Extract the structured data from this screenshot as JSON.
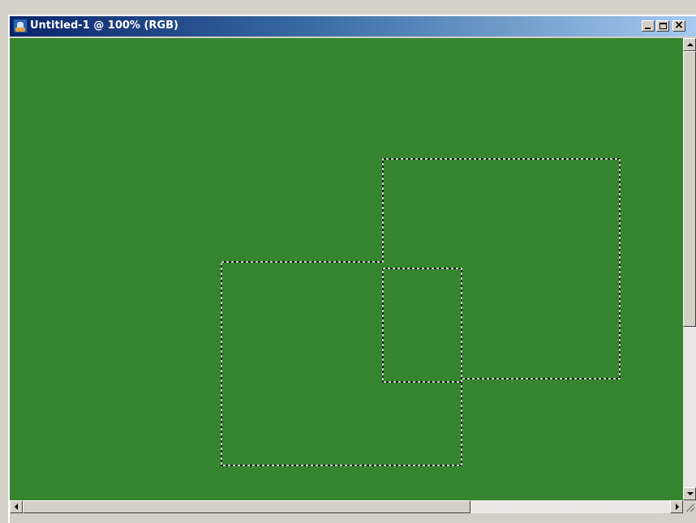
{
  "window": {
    "title": "Untitled-1 @ 100% (RGB)",
    "icon": "photoshop-document-icon",
    "controls": {
      "minimize": "minimize-icon",
      "maximize": "maximize-icon",
      "close": "close-icon",
      "close_glyph": "×"
    }
  },
  "canvas": {
    "fill_color": "#35852f",
    "selection_style": "marching-ants-dashed",
    "selection_count": 2
  },
  "scrollbars": {
    "vertical": {
      "position": 0.0,
      "visible_fraction": 0.6
    },
    "horizontal": {
      "position": 0.0,
      "visible_fraction": 0.7
    }
  },
  "colors": {
    "title_gradient_start": "#0a246a",
    "title_gradient_end": "#a6caf0",
    "chrome": "#d4d0c8"
  }
}
